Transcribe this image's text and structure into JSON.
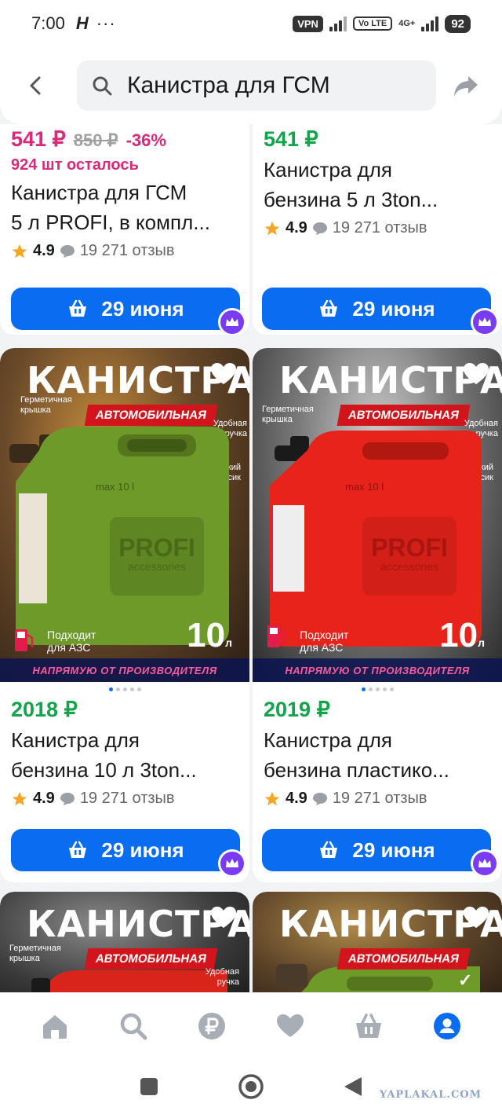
{
  "status": {
    "time": "7:00",
    "carrier_mark": "H",
    "dots": "···",
    "vpn": "VPN",
    "volte": "Vo LTE",
    "network": "4G+",
    "battery": "92"
  },
  "search": {
    "query": "Канистра для ГСМ",
    "icons": {
      "back": "arrow-left-icon",
      "search": "search-icon",
      "share": "share-icon"
    }
  },
  "products": [
    {
      "price": "541 ₽",
      "old_price": "850 ₽",
      "discount": "-36%",
      "stock_left": "924 шт осталось",
      "title_line1": "Канистра для ГСМ",
      "title_line2": "5 л PROFI, в компл...",
      "rating": "4.9",
      "reviews": "19 271 отзыв",
      "delivery": "29 июня"
    },
    {
      "price": "541 ₽",
      "title_line1": "Канистра для",
      "title_line2": "бензина 5 л 3ton...",
      "rating": "4.9",
      "reviews": "19 271 отзыв",
      "delivery": "29 июня"
    },
    {
      "price": "2018 ₽",
      "title_line1": "Канистра для",
      "title_line2": "бензина 10 л 3ton...",
      "rating": "4.9",
      "reviews": "19 271 отзыв",
      "delivery": "29 июня",
      "image": {
        "title": "КАНИСТРА",
        "banner": "АВТОМОБИЛЬНАЯ",
        "note_lid": "Герметичная крышка",
        "note_handle": "Удобная ручка",
        "note_spout": "Гибкий носик",
        "mark": "max 10 l",
        "brand_main": "PROFI",
        "brand_sub": "accessories",
        "azs": "Подходит для АЗС",
        "volume": "10",
        "unit": "л",
        "bottom_text": "НАПРЯМУЮ ОТ ПРОИЗВОДИТЕЛЯ",
        "color": "#6e9a2a"
      }
    },
    {
      "price": "2019 ₽",
      "title_line1": "Канистра для",
      "title_line2": "бензина пластико...",
      "rating": "4.9",
      "reviews": "19 271 отзыв",
      "delivery": "29 июня",
      "image": {
        "title": "КАНИСТРА",
        "banner": "АВТОМОБИЛЬНАЯ",
        "note_lid": "Герметичная крышка",
        "note_handle": "Удобная ручка",
        "note_spout": "Гибкий носик",
        "mark": "max 10 l",
        "brand_main": "PROFI",
        "brand_sub": "accessories",
        "azs": "Подходит для АЗС",
        "volume": "10",
        "unit": "л",
        "bottom_text": "НАПРЯМУЮ ОТ ПРОИЗВОДИТЕЛЯ",
        "color": "#e8231b"
      }
    },
    {
      "image": {
        "title": "КАНИСТРА",
        "banner": "АВТОМОБИЛЬНАЯ",
        "note_lid": "Герметичная крышка",
        "note_handle": "Удобная ручка",
        "color": "#d8241a"
      }
    },
    {
      "image": {
        "title": "КАНИСТРА",
        "banner": "АВТОМОБИЛЬНАЯ",
        "check": "✓",
        "color": "#6e9a2a"
      }
    }
  ],
  "bottom_nav": [
    "home-icon",
    "search-icon",
    "ruble-icon",
    "heart-icon",
    "basket-icon",
    "profile-icon"
  ],
  "bottom_nav_active_color": "#0a6cf0",
  "system_nav": [
    "recents-icon",
    "home-circle-icon",
    "back-triangle-icon"
  ],
  "watermark": "YAPLAKAL.COM"
}
